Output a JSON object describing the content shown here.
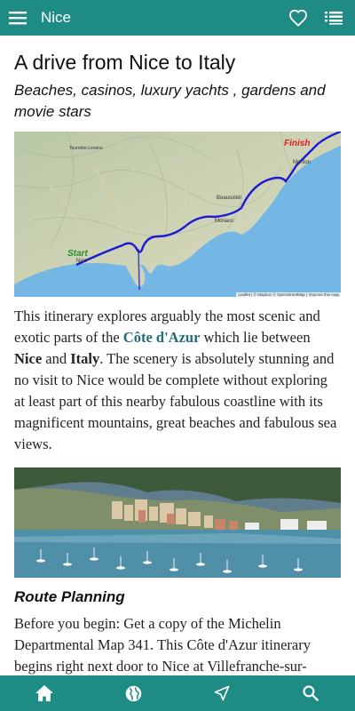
{
  "header": {
    "title": "Nice",
    "menu_icon": "hamburger-menu-icon",
    "favorite_icon": "heart-icon",
    "list_icon": "list-icon"
  },
  "article": {
    "title": "A drive from Nice to Italy",
    "subtitle": "Beaches, casinos, luxury yachts , gardens and movie stars",
    "map": {
      "start_label": "Start",
      "finish_label": "Finish",
      "places": [
        "Nice",
        "Monaco",
        "Beausoleil",
        "Menton",
        "Tourrette-Levens"
      ],
      "attribution": "Leaflet | © Mapbox © OpenStreetMap | Improve this map"
    },
    "intro": {
      "t1": "This itinerary explores arguably the most scenic and exotic parts of the ",
      "link": "Côte d'Azur",
      "t2": " which lie between ",
      "b1": "Nice",
      "t3": " and ",
      "b2": "Italy",
      "t4": ". The scenery is absolutely stunning and no visit to Nice would be complete without exploring at least part of this nearby fabulous coastline with its magnificent mountains, great beaches and fabulous sea views."
    },
    "section_title": "Route Planning",
    "route_text": "Before you begin: Get a copy of the Michelin Departmental Map 341. This Côte d'Azur itinerary begins right next door to Nice at Villefranche-sur-"
  },
  "bottom_nav": {
    "items": [
      "home-icon",
      "globe-icon",
      "navigation-arrow-icon",
      "search-icon"
    ]
  },
  "colors": {
    "bar": "#1e8c84",
    "link": "#1f6e7a",
    "route": "#1b1bd6",
    "start": "#2e8b2e",
    "finish": "#e21b1b",
    "sea": "#74b6e4"
  }
}
